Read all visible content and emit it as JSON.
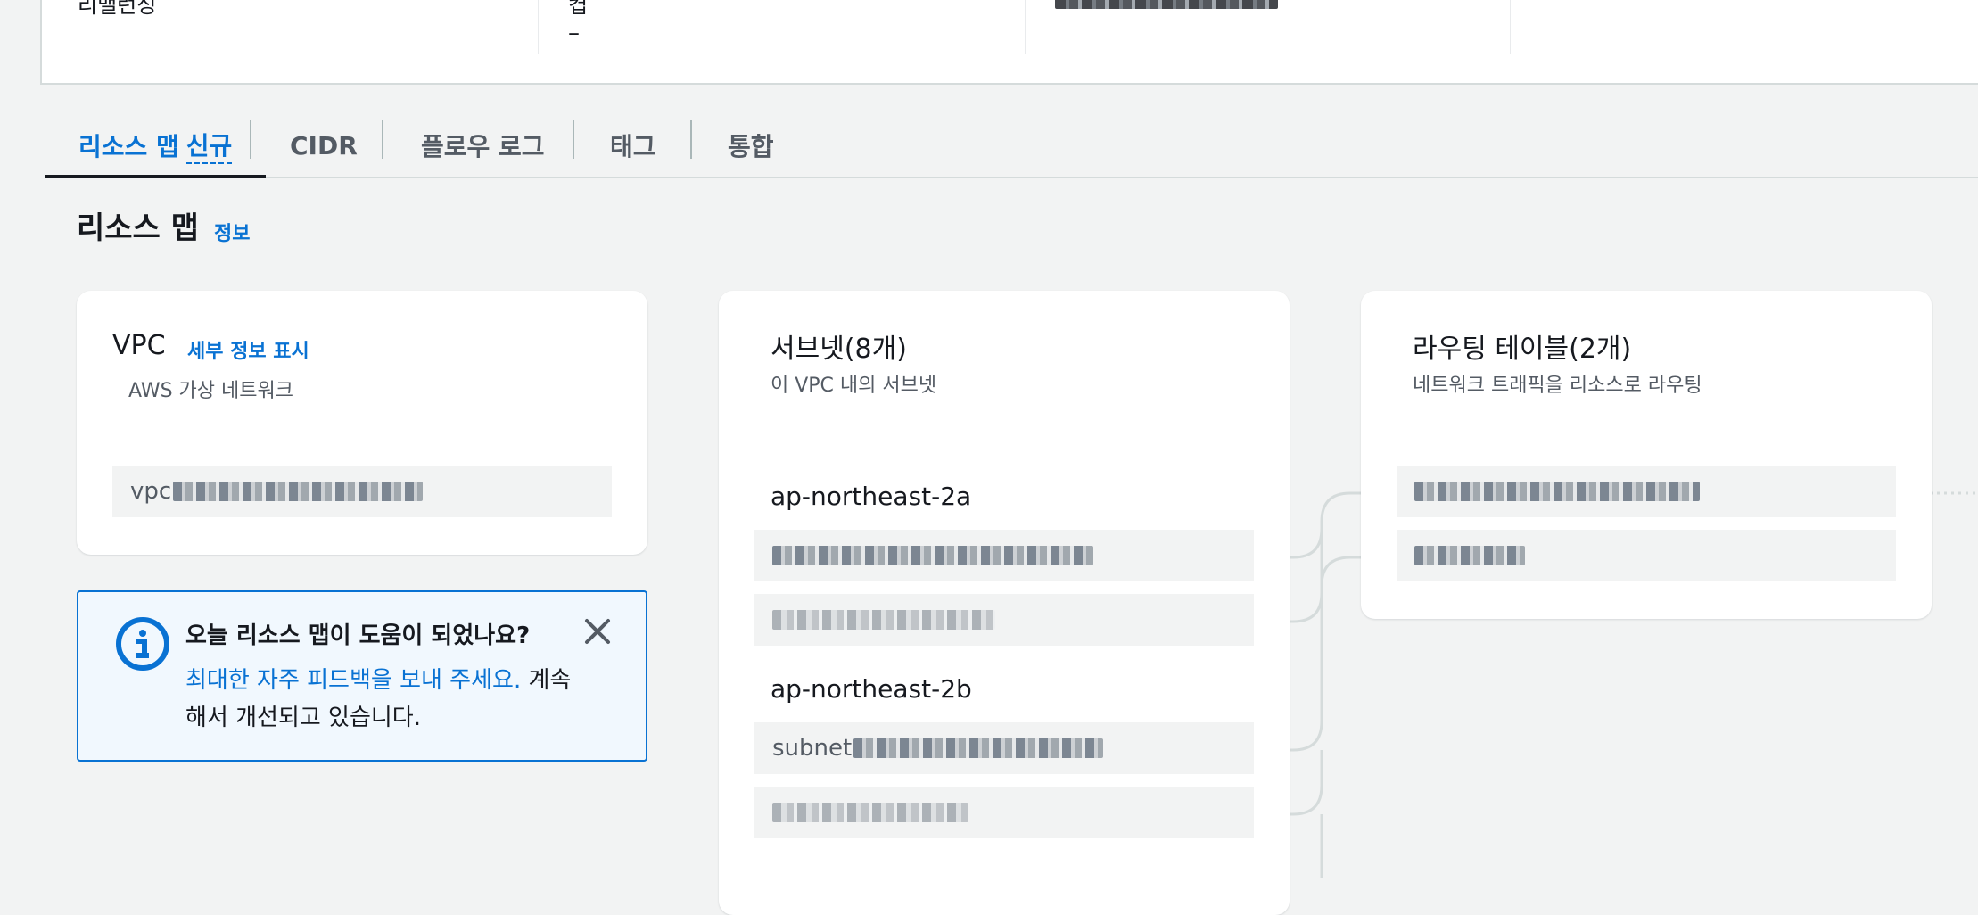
{
  "top_panel": {
    "col1_cut_text": "리밸런싱",
    "col2_cut_text": "켭",
    "col2_value": "–"
  },
  "tabs": [
    {
      "label": "리소스 맵",
      "badge": "신규",
      "active": true
    },
    {
      "label": "CIDR"
    },
    {
      "label": "플로우 로그"
    },
    {
      "label": "태그"
    },
    {
      "label": "통합"
    }
  ],
  "section": {
    "title": "리소스 맵",
    "info_link": "정보"
  },
  "vpc_card": {
    "title": "VPC",
    "details_link": "세부 정보 표시",
    "subtitle": "AWS 가상 네트워크",
    "resource_prefix": "vpc"
  },
  "feedback": {
    "title": "오늘 리소스 맵이 도움이 되었나요?",
    "link_text": "최대한 자주 피드백을 보내 주세요.",
    "body_text": " 계속해서 개선되고 있습니다."
  },
  "subnets_card": {
    "title": "서브넷(8개)",
    "subtitle": "이 VPC 내의 서브넷",
    "groups": [
      {
        "az": "ap-northeast-2a"
      },
      {
        "az": "ap-northeast-2b"
      }
    ],
    "subnet_prefix": "subnet"
  },
  "route_card": {
    "title": "라우팅 테이블(2개)",
    "subtitle": "네트워크 트래픽을 리소스로 라우팅"
  },
  "colors": {
    "accent": "#0972d3",
    "background": "#f2f3f3",
    "card": "#ffffff",
    "text": "#16191f"
  },
  "icons": [
    "info-icon",
    "close-icon"
  ]
}
